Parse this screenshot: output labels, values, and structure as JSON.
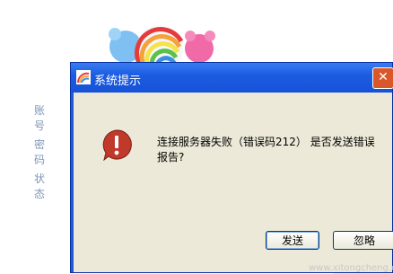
{
  "background_window": {
    "labels": [
      "账号",
      "密码",
      "状态"
    ]
  },
  "dialog": {
    "title": "系统提示",
    "close_glyph": "✕",
    "message": "连接服务器失败（错误码212） 是否发送错误报告?",
    "buttons": {
      "send": "发送",
      "ignore": "忽略"
    },
    "icon": "error-icon",
    "watermark": "www.xitongcheng.com"
  },
  "colors": {
    "titlebar": "#1f5bd8",
    "client": "#ece9d8",
    "error_icon": "#c0392b",
    "label_text": "#7f97b8"
  }
}
